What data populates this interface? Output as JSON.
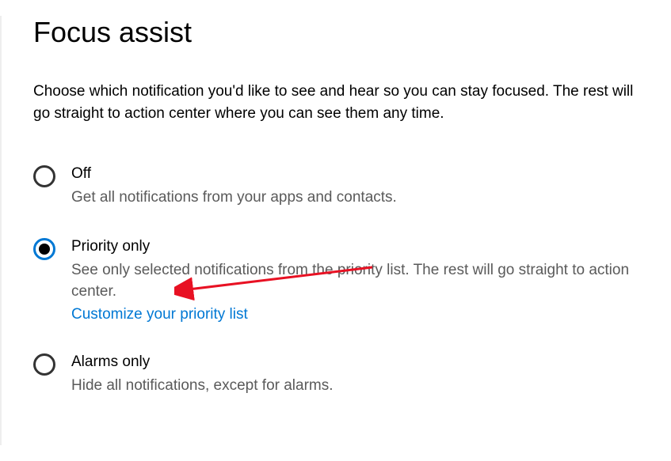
{
  "title": "Focus assist",
  "description": "Choose which notification you'd like to see and hear so you can stay focused. The rest will go straight to action center where you can see them any time.",
  "options": {
    "off": {
      "label": "Off",
      "sub": "Get all notifications from your apps and contacts.",
      "selected": false
    },
    "priority": {
      "label": "Priority only",
      "sub": "See only selected notifications from the priority list. The rest will go straight to action center.",
      "link": "Customize your priority list",
      "selected": true
    },
    "alarms": {
      "label": "Alarms only",
      "sub": "Hide all notifications, except for alarms.",
      "selected": false
    }
  },
  "annotation": {
    "arrow_color": "#e81123"
  }
}
